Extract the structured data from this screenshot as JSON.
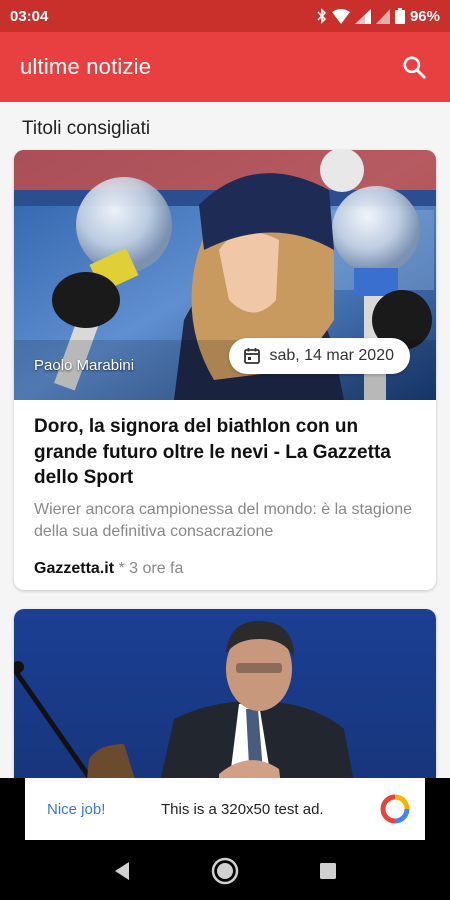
{
  "status_bar": {
    "time": "03:04",
    "battery": "96%",
    "icons": [
      "bluetooth-icon",
      "wifi-icon",
      "signal-icon",
      "signal-icon",
      "battery-icon"
    ]
  },
  "app_bar": {
    "title": "ultime notizie",
    "search_icon": "search-icon",
    "color": "#e84040"
  },
  "section": {
    "title": "Titoli consigliati"
  },
  "articles": [
    {
      "photo_credit": "Paolo Marabini",
      "date": "sab, 14 mar 2020",
      "headline": "Doro, la signora del biathlon con un grande futuro oltre le nevi - La Gazzetta dello Sport",
      "summary": "Wierer ancora campionessa del mondo: è la stagione della sua definitiva consacrazione",
      "source": "Gazzetta.it",
      "time_ago": " * 3 ore fa"
    },
    {
      "photo_credit": "",
      "date": "",
      "headline": "",
      "summary": "",
      "source": "",
      "time_ago": ""
    }
  ],
  "ad": {
    "cta": "Nice job!",
    "text": "This is a 320x50 test ad."
  },
  "nav": {
    "back": "back-icon",
    "home": "home-icon",
    "recents": "recents-icon"
  }
}
